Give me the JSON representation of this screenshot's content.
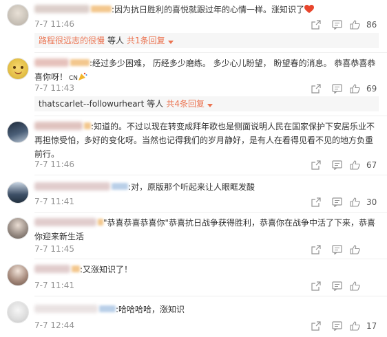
{
  "comments": [
    {
      "text": ":因为抗日胜利的喜悦就跟过年的心情一样。涨知识了",
      "time": "7-7 11:46",
      "likes": "86",
      "avatar_color": "#c9c2b8",
      "reply_user": "路程很远志的很慢",
      "reply_mid": "等人",
      "reply_count": "共1条回复"
    },
    {
      "text": ":经过多少困难， 历经多少磨练。 多少心儿盼望， 盼望春的消息。 恭喜恭喜恭喜你呀！",
      "cn": "CN",
      "time": "7-7 11:43",
      "likes": "69",
      "avatar_color": "#e6c24a",
      "reply_user": "thatscarlet--followurheart",
      "reply_mid": "等人",
      "reply_count": "共4条回复"
    },
    {
      "text": ":知道的。不过以现在转变成拜年歌也是侧面说明人民在国家保护下安居乐业不再担惊受怕，多好的变化呀。当然也记得我们的岁月静好，是有人在看得见看不见的地方负重前行。",
      "time": "7-7 11:46",
      "likes": "67",
      "avatar_color": "#4b5f78"
    },
    {
      "text": ":对，原版那个听起来让人眼眶发酸",
      "time": "7-7 11:41",
      "likes": "30",
      "avatar_color": "#3d4f66"
    },
    {
      "text": "\"恭喜恭喜恭喜你\"恭喜抗日战争获得胜利，恭喜你在战争中活了下来，恭喜你迎来新生活",
      "time": "7-7 11:45",
      "likes": "",
      "avatar_color": "#9a8e86"
    },
    {
      "text": ":又涨知识了！",
      "time": "7-7 11:41",
      "likes": "",
      "avatar_color": "#a88c7e"
    },
    {
      "text": ":哈哈哈哈，涨知识",
      "time": "7-7 12:44",
      "likes": "17",
      "avatar_color": "#dcdcdc"
    }
  ],
  "colors": {
    "accent": "#eb7350",
    "meta": "#939393",
    "heart": "#e8452c"
  }
}
